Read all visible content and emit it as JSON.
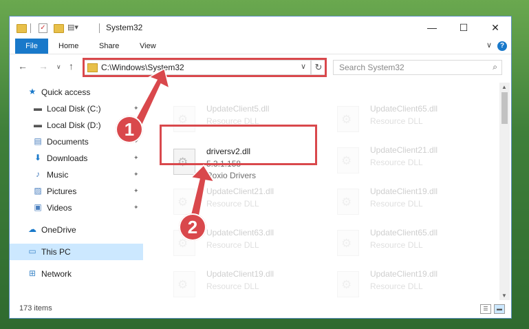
{
  "window": {
    "title": "System32",
    "minimize_glyph": "—",
    "maximize_glyph": "☐",
    "close_glyph": "✕"
  },
  "ribbon": {
    "tabs": [
      "File",
      "Home",
      "Share",
      "View"
    ],
    "expand_glyph": "∨",
    "help_glyph": "?"
  },
  "navigation": {
    "back_glyph": "←",
    "forward_glyph": "→",
    "recent_glyph": "∨",
    "up_glyph": "↑",
    "address": "C:\\Windows\\System32",
    "address_dropdown_glyph": "∨",
    "refresh_glyph": "↻",
    "search_placeholder": "Search System32",
    "search_glyph": "⌕"
  },
  "sidebar": {
    "items": [
      {
        "label": "Quick access",
        "icon": "star-icon",
        "glyph": "★",
        "pinned": false
      },
      {
        "label": "Local Disk (C:)",
        "icon": "drive-icon",
        "glyph": "▬",
        "pinned": true
      },
      {
        "label": "Local Disk (D:)",
        "icon": "drive-icon",
        "glyph": "▬",
        "pinned": true
      },
      {
        "label": "Documents",
        "icon": "documents-icon",
        "glyph": "▤",
        "pinned": true
      },
      {
        "label": "Downloads",
        "icon": "download-icon",
        "glyph": "⬇",
        "pinned": true
      },
      {
        "label": "Music",
        "icon": "music-icon",
        "glyph": "♪",
        "pinned": true
      },
      {
        "label": "Pictures",
        "icon": "pictures-icon",
        "glyph": "▨",
        "pinned": true
      },
      {
        "label": "Videos",
        "icon": "videos-icon",
        "glyph": "▣",
        "pinned": true
      },
      {
        "label": "OneDrive",
        "icon": "cloud-icon",
        "glyph": "☁",
        "pinned": false
      },
      {
        "label": "This PC",
        "icon": "computer-icon",
        "glyph": "▭",
        "pinned": false
      },
      {
        "label": "Network",
        "icon": "network-icon",
        "glyph": "⊞",
        "pinned": false
      }
    ],
    "pin_glyph": "📌"
  },
  "files": {
    "left": [
      {
        "name": "UpdateClient5.dll",
        "type": "Resource DLL"
      },
      {
        "name": "driversv2.dll",
        "version": "5.3.1.158",
        "company": "Roxio Drivers"
      },
      {
        "name": "UpdateClient21.dll",
        "type": "Resource DLL"
      },
      {
        "name": "UpdateClient63.dll",
        "type": "Resource DLL"
      },
      {
        "name": "UpdateClient19.dll",
        "type": "Resource DLL"
      }
    ],
    "right": [
      {
        "name": "UpdateClient65.dll",
        "type": "Resource DLL"
      },
      {
        "name": "UpdateClient21.dll",
        "type": "Resource DLL"
      },
      {
        "name": "UpdateClient19.dll",
        "type": "Resource DLL"
      },
      {
        "name": "UpdateClient65.dll",
        "type": "Resource DLL"
      },
      {
        "name": "UpdateClient19.dll",
        "type": "Resource DLL"
      }
    ]
  },
  "status": {
    "item_count": "173 items"
  },
  "annotations": {
    "marker_1": "1",
    "marker_2": "2",
    "highlight_color": "#d9484c"
  }
}
